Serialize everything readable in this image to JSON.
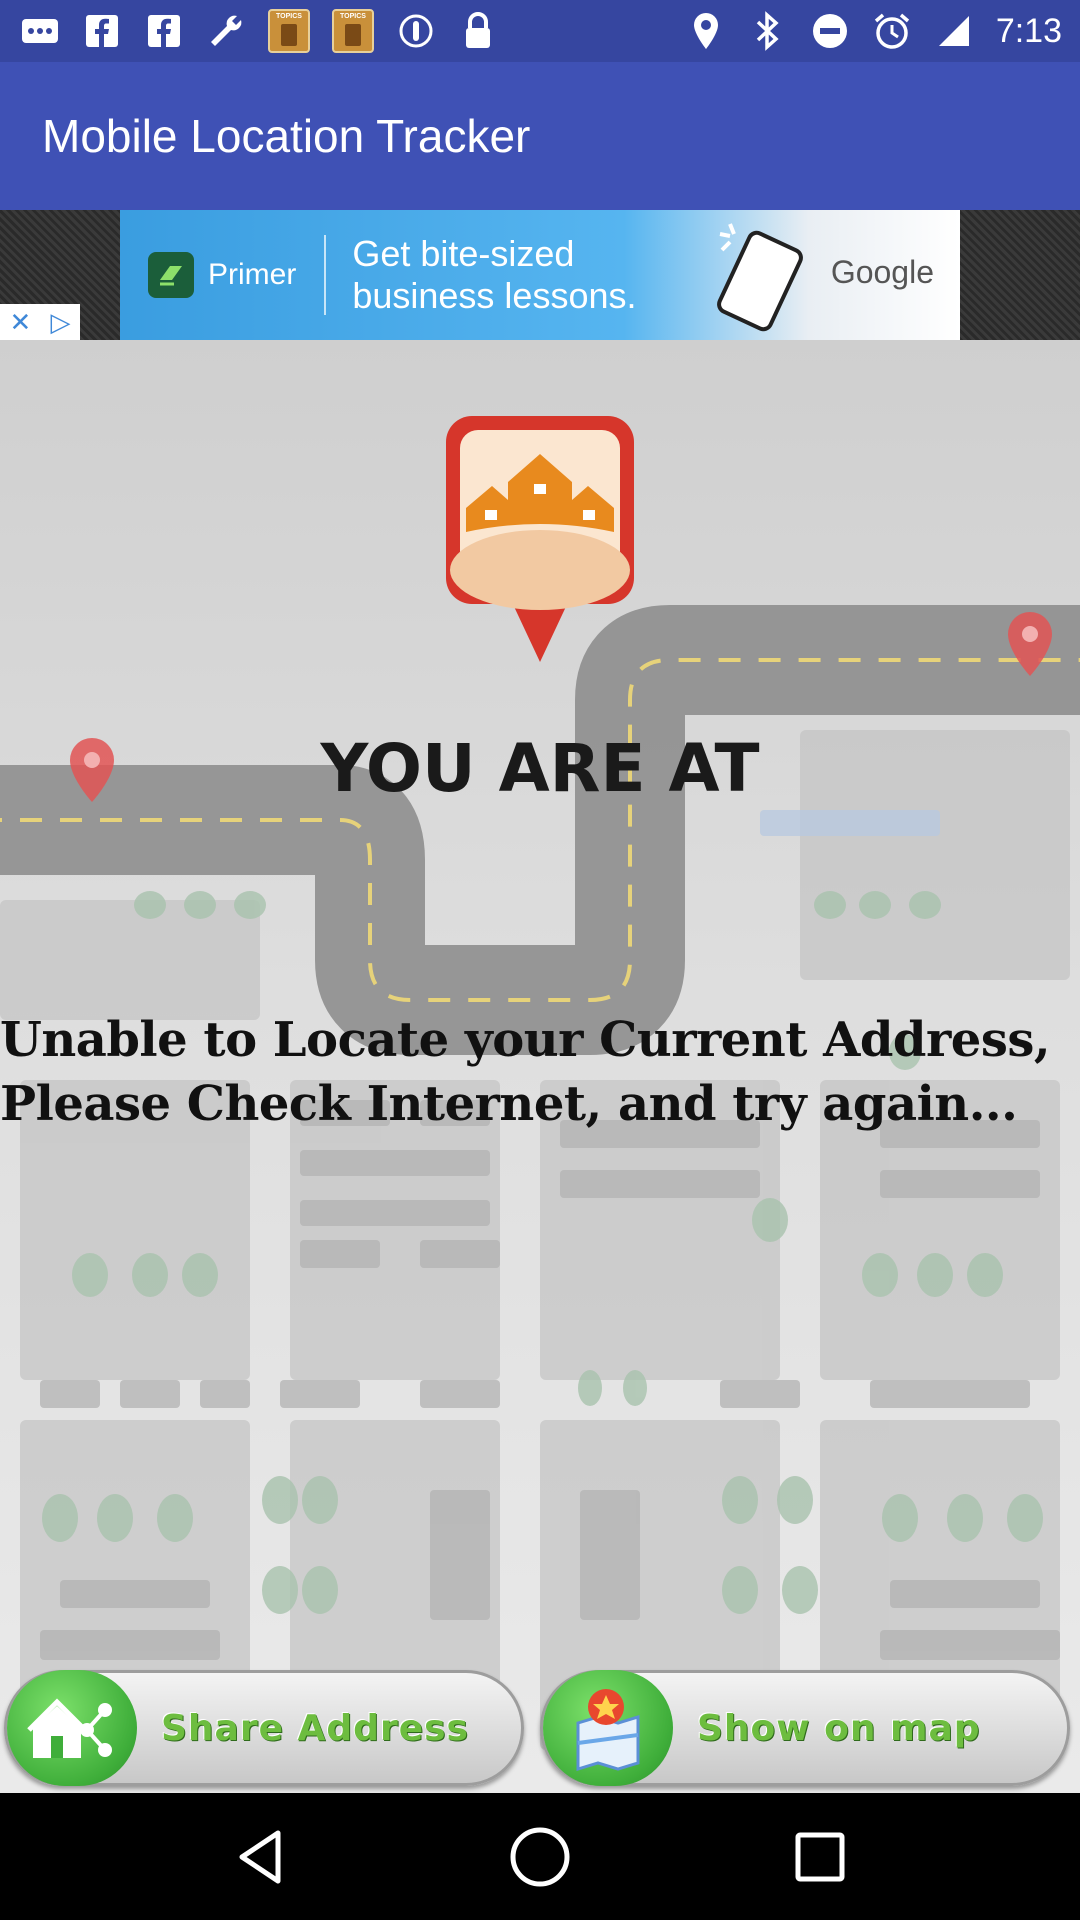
{
  "status_bar": {
    "time": "7:13",
    "left_icons": [
      "more-icon",
      "facebook-icon",
      "facebook-icon",
      "wrench-icon",
      "topics-app-icon",
      "topics-app-icon",
      "alert-icon",
      "lock-icon"
    ],
    "right_icons": [
      "location-icon",
      "bluetooth-icon",
      "do-not-disturb-icon",
      "alarm-icon",
      "signal-icon"
    ],
    "topics_label": "TOPICS"
  },
  "app_bar": {
    "title": "Mobile Location Tracker",
    "color": "#3f51b5"
  },
  "ad": {
    "brand": "Primer",
    "text": "Get bite-sized business lessons.",
    "sponsor": "Google"
  },
  "main": {
    "heading": "YOU ARE AT",
    "address": "Unable to Locate your Current Address, Please Check Internet, and try again..."
  },
  "buttons": {
    "share_label": "Share Address",
    "map_label": "Show on map"
  },
  "nav": {
    "icons": [
      "back-icon",
      "home-icon",
      "recents-icon"
    ]
  }
}
